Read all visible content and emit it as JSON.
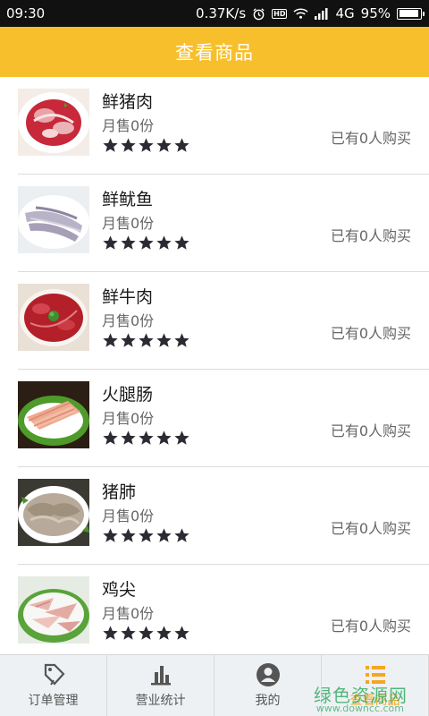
{
  "status_bar": {
    "time": "09:30",
    "speed": "0.37K/s",
    "network": "4G",
    "battery": "95%",
    "battery_level": 0.95
  },
  "header": {
    "title": "查看商品"
  },
  "products": [
    {
      "name": "鲜猪肉",
      "sales": "月售0份",
      "buyers": "已有0人购买",
      "rating": 5,
      "thumb": "raw-pork-slices"
    },
    {
      "name": "鲜鱿鱼",
      "sales": "月售0份",
      "buyers": "已有0人购买",
      "rating": 5,
      "thumb": "squid-strips"
    },
    {
      "name": "鲜牛肉",
      "sales": "月售0份",
      "buyers": "已有0人购买",
      "rating": 5,
      "thumb": "beef-slices"
    },
    {
      "name": "火腿肠",
      "sales": "月售0份",
      "buyers": "已有0人购买",
      "rating": 5,
      "thumb": "ham-sausage-slices"
    },
    {
      "name": "猪肺",
      "sales": "月售0份",
      "buyers": "已有0人购买",
      "rating": 5,
      "thumb": "pork-lung-slices"
    },
    {
      "name": "鸡尖",
      "sales": "月售0份",
      "buyers": "已有0人购买",
      "rating": 5,
      "thumb": "chicken-tips"
    }
  ],
  "bottom_nav": [
    {
      "label": "订单管理",
      "icon": "tag-icon",
      "active": false
    },
    {
      "label": "营业统计",
      "icon": "bar-chart-icon",
      "active": false
    },
    {
      "label": "我的",
      "icon": "user-icon",
      "active": false
    },
    {
      "label": "查看商品",
      "icon": "list-icon",
      "active": true
    }
  ],
  "watermark": {
    "text": "绿色资源网",
    "sub": "www.downcc.com"
  },
  "colors": {
    "accent": "#f8bf2c",
    "star": "#2b2b33",
    "active_nav": "#f5a623"
  }
}
